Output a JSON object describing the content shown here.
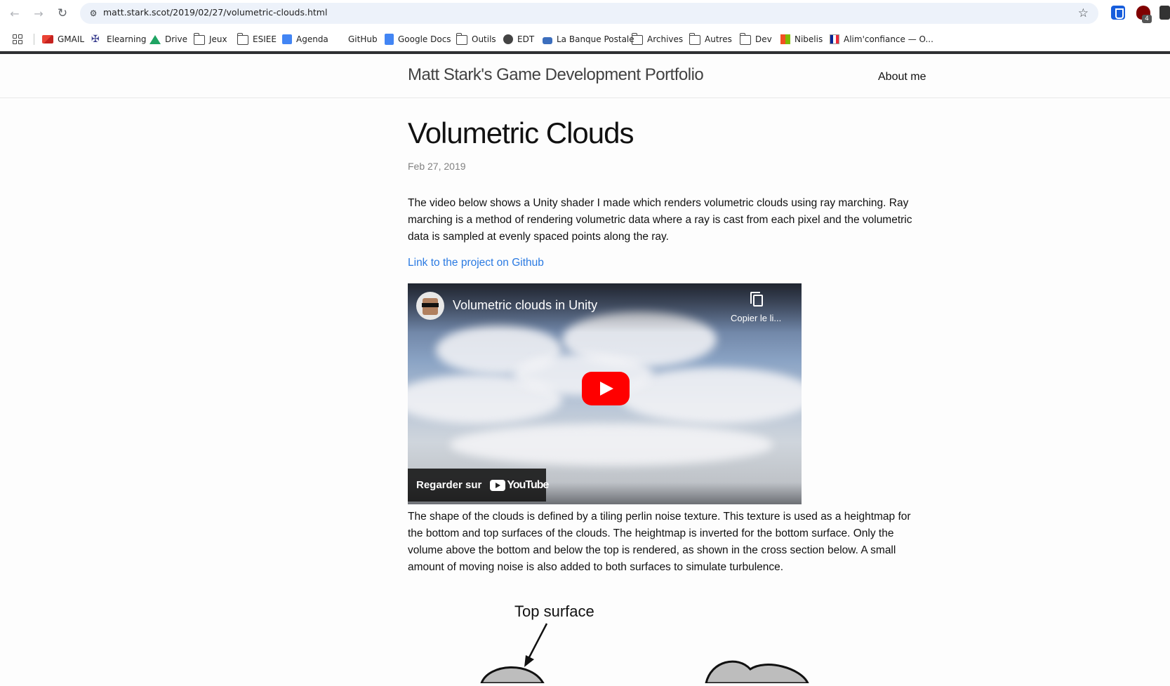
{
  "browser": {
    "url": "matt.stark.scot/2019/02/27/volumetric-clouds.html",
    "ext_badge": "4",
    "bookmarks": [
      {
        "label": "GMAIL",
        "icon": "gmail-icon"
      },
      {
        "label": "Elearning",
        "icon": "elearning-icon"
      },
      {
        "label": "Drive",
        "icon": "drive-icon"
      },
      {
        "label": "Jeux",
        "icon": "folder-icon"
      },
      {
        "label": "ESIEE",
        "icon": "folder-icon"
      },
      {
        "label": "Agenda",
        "icon": "calendar-icon"
      },
      {
        "label": "GitHub",
        "icon": "github-icon"
      },
      {
        "label": "Google Docs",
        "icon": "docs-icon"
      },
      {
        "label": "Outils",
        "icon": "folder-icon"
      },
      {
        "label": "EDT",
        "icon": "globe-icon"
      },
      {
        "label": "La Banque Postale",
        "icon": "bank-icon"
      },
      {
        "label": "Archives",
        "icon": "folder-icon"
      },
      {
        "label": "Autres",
        "icon": "folder-icon"
      },
      {
        "label": "Dev",
        "icon": "folder-icon"
      },
      {
        "label": "Nibelis",
        "icon": "microsoft-icon"
      },
      {
        "label": "Alim'confiance — O...",
        "icon": "gov-icon"
      }
    ]
  },
  "site": {
    "title": "Matt Stark's Game Development Portfolio",
    "nav_about": "About me"
  },
  "post": {
    "title": "Volumetric Clouds",
    "date": "Feb 27, 2019",
    "intro": "The video below shows a Unity shader I made which renders volumetric clouds using ray marching. Ray marching is a method of rendering volumetric data where a ray is cast from each pixel and the volumetric data is sampled at evenly spaced points along the ray.",
    "github_link": "Link to the project on Github",
    "video": {
      "title": "Volumetric clouds in Unity",
      "copy_label": "Copier le li...",
      "watch_on": "Regarder sur",
      "yt_word": "YouTube"
    },
    "body": "The shape of the clouds is defined by a tiling perlin noise texture. This texture is used as a heightmap for the bottom and top surfaces of the clouds. The heightmap is inverted for the bottom surface. Only the volume above the bottom and below the top is rendered, as shown in the cross section below. A small amount of moving noise is also added to both surfaces to simulate turbulence.",
    "diagram_label": "Top surface"
  },
  "colors": {
    "link": "#2a7ae2",
    "play_button": "#ff0000",
    "omnibox": "#edf2fa"
  }
}
